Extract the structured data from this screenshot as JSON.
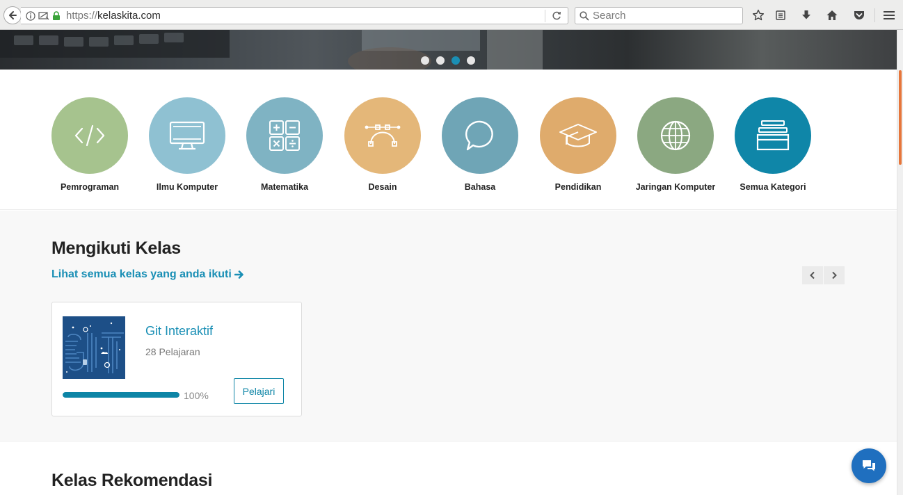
{
  "browser": {
    "url_protocol": "https://",
    "url_host": "kelaskita.com",
    "search_placeholder": "Search"
  },
  "hero": {
    "slide_count": 4,
    "active_slide": 3
  },
  "categories": [
    {
      "label": "Pemrograman",
      "icon": "code-icon",
      "color": "#a6c38e"
    },
    {
      "label": "Ilmu Komputer",
      "icon": "monitor-icon",
      "color": "#8fc1d2"
    },
    {
      "label": "Matematika",
      "icon": "calculator-icon",
      "color": "#7fb3c3"
    },
    {
      "label": "Desain",
      "icon": "bezier-pen-icon",
      "color": "#e4b779"
    },
    {
      "label": "Bahasa",
      "icon": "speech-bubble-icon",
      "color": "#6fa5b6"
    },
    {
      "label": "Pendidikan",
      "icon": "graduation-cap-icon",
      "color": "#dfab6c"
    },
    {
      "label": "Jaringan Komputer",
      "icon": "globe-icon",
      "color": "#8ba881"
    },
    {
      "label": "Semua Kategori",
      "icon": "stack-icon",
      "color": "#0f86a8"
    }
  ],
  "following": {
    "title": "Mengikuti Kelas",
    "see_all": "Lihat semua kelas yang anda ikuti",
    "course": {
      "title": "Git Interaktif",
      "lessons": "28 Pelajaran",
      "progress": 1.0,
      "progress_label": "100%",
      "button": "Pelajari"
    }
  },
  "recommended": {
    "title": "Kelas Rekomendasi"
  }
}
